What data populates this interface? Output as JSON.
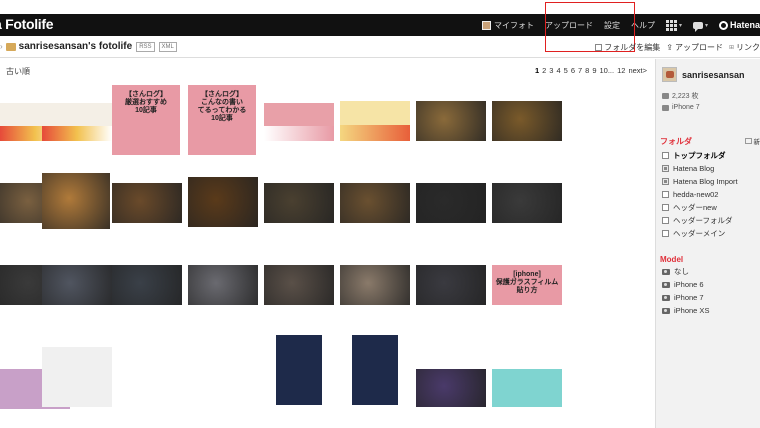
{
  "brand": {
    "text": "a Fotolife"
  },
  "global_nav": {
    "my_photo": "マイフォト",
    "upload": "アップロード",
    "settings": "設定",
    "help": "ヘルプ",
    "hatena": "Hatena"
  },
  "breadcrumb": {
    "title": "sanrisesansan's fotolife",
    "rss": "RSS",
    "xml": "XML"
  },
  "sub_actions": {
    "edit_folder": "フォルダを編集",
    "upload": "アップロード",
    "link": "リンク"
  },
  "main": {
    "sort_label": "古い順",
    "pager": {
      "pages": [
        "1",
        "2",
        "3",
        "4",
        "5",
        "6",
        "7",
        "8",
        "9",
        "10...",
        "12"
      ],
      "next": "next>"
    },
    "thumb_captions": {
      "c1": "【さんログ】\n厳選おすすめ\n10記事",
      "c2": "【さんログ】\nこんなの書い\nてるってわかる\n10記事",
      "c3": "[iphone]\n保護ガラスフィルム\n貼り方"
    }
  },
  "sidebar": {
    "username": "sanrisesansan",
    "photo_count": "2,223 枚",
    "device": "iPhone 7",
    "folder_title": "フォルダ",
    "new_folder": "新",
    "folders": [
      "トップフォルダ",
      "Hatena Blog",
      "Hatena Blog Import",
      "hedda-new02",
      "ヘッダーnew",
      "ヘッダーフォルダ",
      "ヘッダーメイン"
    ],
    "model_title": "Model",
    "models": [
      "なし",
      "iPhone 6",
      "iPhone 7",
      "iPhone XS"
    ]
  },
  "colors": {
    "accent_red": "#e0303a",
    "topbar": "#111111",
    "pink_card": "#e89aa5"
  }
}
